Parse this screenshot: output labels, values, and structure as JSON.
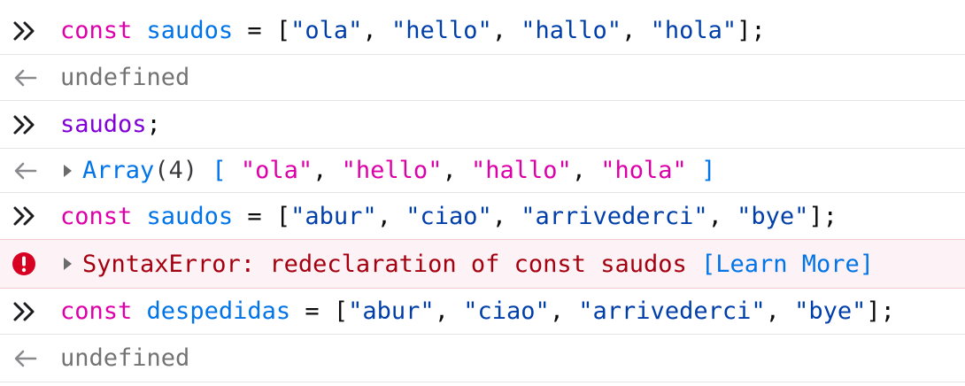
{
  "rows": [
    {
      "type": "input",
      "tokens": {
        "kw": "const",
        "var": "saudos",
        "eq": " = ",
        "open": "[",
        "items": [
          "\"ola\"",
          "\"hello\"",
          "\"hallo\"",
          "\"hola\""
        ],
        "sep": ", ",
        "close": "];"
      }
    },
    {
      "type": "output",
      "text": "undefined"
    },
    {
      "type": "input",
      "ident": "saudos",
      "semicolon": ";"
    },
    {
      "type": "output",
      "label": "Array",
      "count": "(4)",
      "open": "[",
      "items": [
        "\"ola\"",
        "\"hello\"",
        "\"hallo\"",
        "\"hola\""
      ],
      "sep": ", ",
      "close": "]"
    },
    {
      "type": "input",
      "tokens": {
        "kw": "const",
        "var": "saudos",
        "eq": " = ",
        "open": "[",
        "items": [
          "\"abur\"",
          "\"ciao\"",
          "\"arrivederci\"",
          "\"bye\""
        ],
        "sep": ", ",
        "close": "];"
      }
    },
    {
      "type": "error",
      "message": "SyntaxError: redeclaration of const saudos",
      "link": "[Learn More]"
    },
    {
      "type": "input",
      "tokens": {
        "kw": "const",
        "var": "despedidas",
        "eq": " = ",
        "open": "[",
        "items": [
          "\"abur\"",
          "\"ciao\"",
          "\"arrivederci\"",
          "\"bye\""
        ],
        "sep": ", ",
        "close": "];"
      }
    },
    {
      "type": "output",
      "text": "undefined"
    }
  ],
  "icons": {
    "input": "chevron-double-right-icon",
    "output": "arrow-left-icon",
    "error": "error-circle-icon",
    "expand": "expand-triangle-icon"
  },
  "colors": {
    "keyword": "#dd00a9",
    "variable": "#0074e8",
    "string": "#003eaa",
    "error_text": "#a4000f",
    "error_bg": "#fdf2f5",
    "error_icon": "#d70022"
  }
}
